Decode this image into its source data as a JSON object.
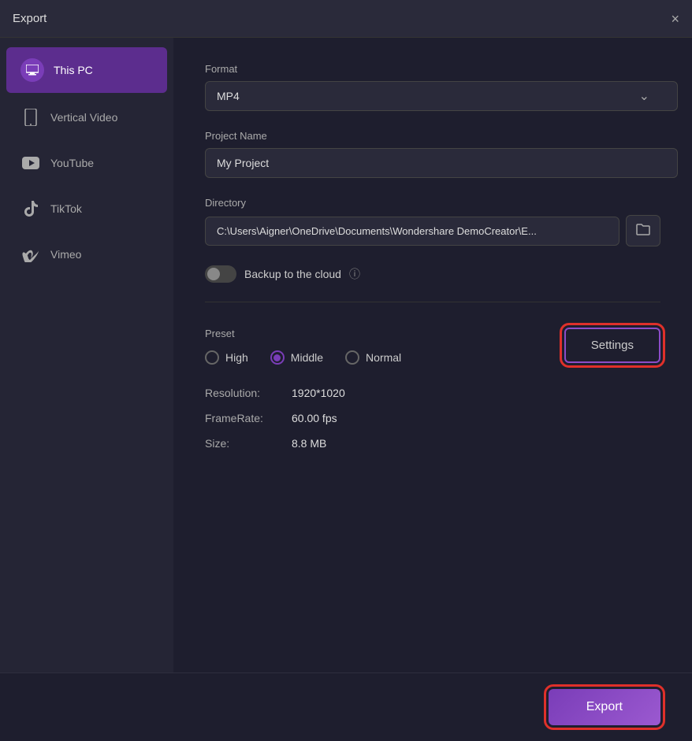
{
  "titleBar": {
    "title": "Export",
    "closeLabel": "×"
  },
  "sidebar": {
    "items": [
      {
        "id": "this-pc",
        "label": "This PC",
        "icon": "💻",
        "active": true
      },
      {
        "id": "vertical-video",
        "label": "Vertical Video",
        "icon": "📱",
        "active": false
      },
      {
        "id": "youtube",
        "label": "YouTube",
        "icon": "▶",
        "active": false
      },
      {
        "id": "tiktok",
        "label": "TikTok",
        "icon": "♪",
        "active": false
      },
      {
        "id": "vimeo",
        "label": "Vimeo",
        "icon": "V",
        "active": false
      }
    ]
  },
  "main": {
    "formatLabel": "Format",
    "formatValue": "MP4",
    "projectNameLabel": "Project Name",
    "projectNameValue": "My Project",
    "directoryLabel": "Directory",
    "directoryValue": "C:\\Users\\Aigner\\OneDrive\\Documents\\Wondershare DemoCreator\\E...",
    "backupLabel": "Backup to the cloud",
    "presetLabel": "Preset",
    "preset": {
      "options": [
        {
          "id": "high",
          "label": "High",
          "selected": false
        },
        {
          "id": "middle",
          "label": "Middle",
          "selected": true
        },
        {
          "id": "normal",
          "label": "Normal",
          "selected": false
        }
      ]
    },
    "settingsLabel": "Settings",
    "resolution": {
      "key": "Resolution:",
      "value": "1920*1020"
    },
    "framerate": {
      "key": "FrameRate:",
      "value": "60.00 fps"
    },
    "size": {
      "key": "Size:",
      "value": "8.8 MB"
    }
  },
  "footer": {
    "exportLabel": "Export"
  }
}
